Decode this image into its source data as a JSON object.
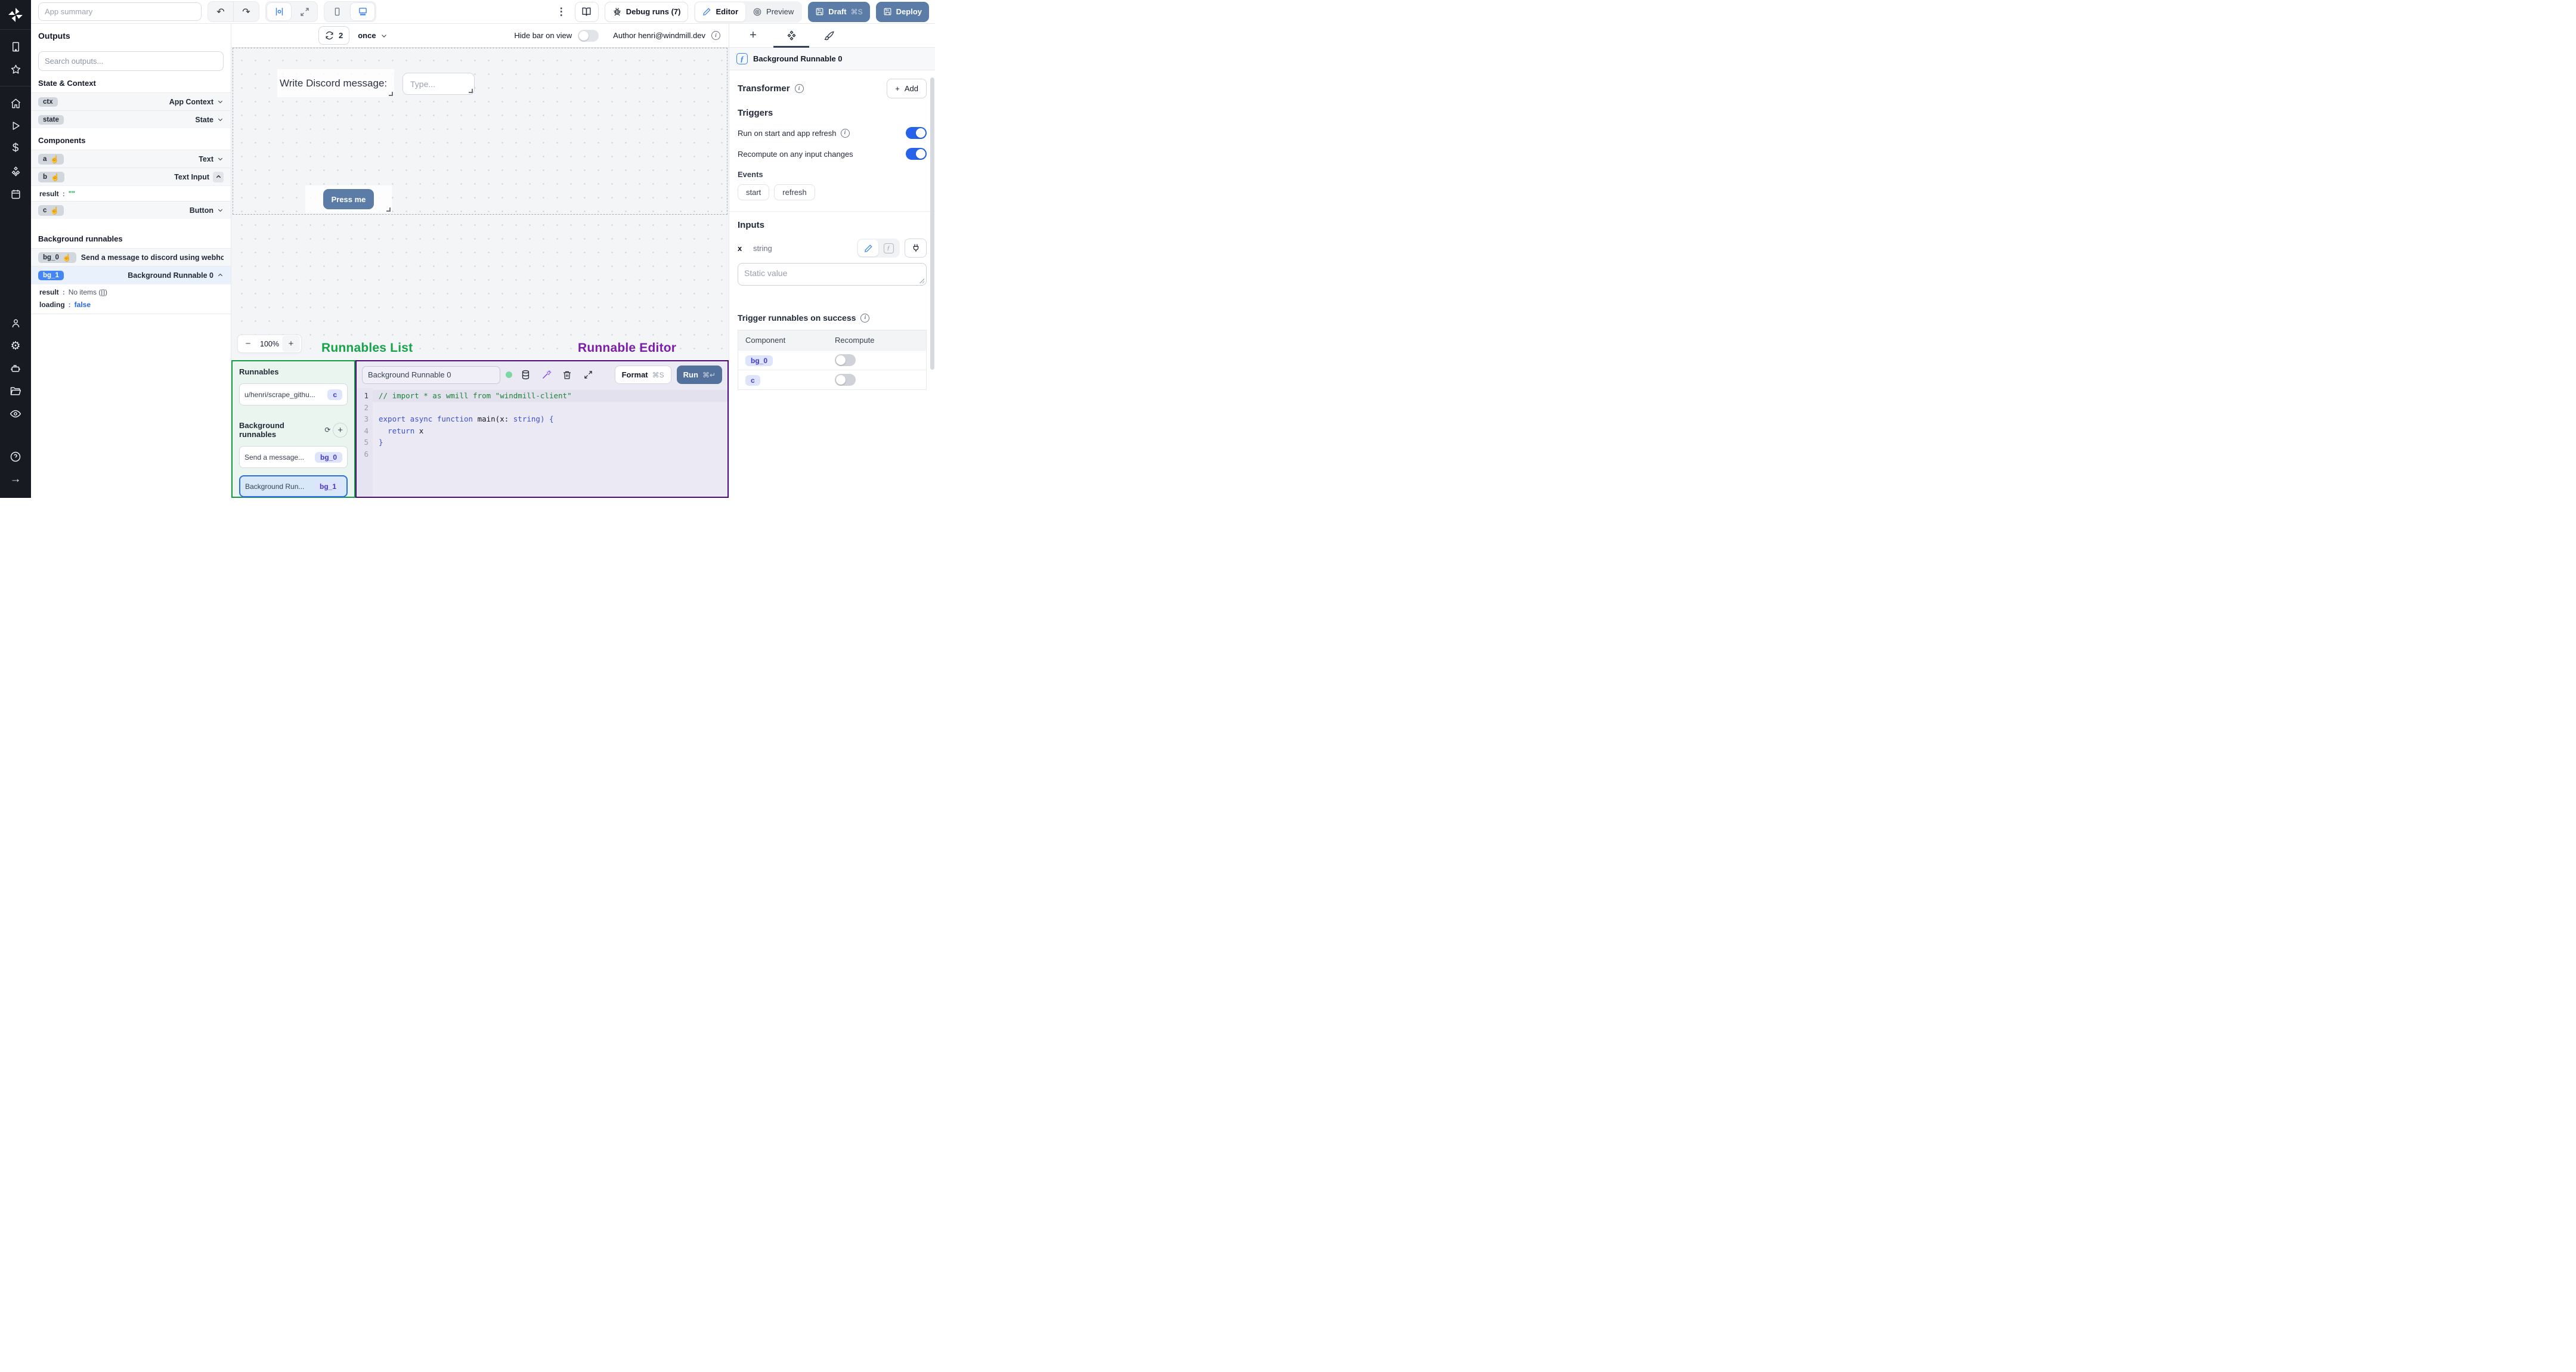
{
  "colors": {
    "accent_blue": "#3b82f6",
    "toggle_on_blue": "#2563eb",
    "slate_button": "#5b7ca6",
    "badge_blue": "#4486f6",
    "indigo_badge_bg": "#dde4fb",
    "indigo_badge_text": "#4338ca",
    "green_annotation": "#16a34a",
    "purple_annotation": "#7b1fa8",
    "green_panel_border": "#179a43",
    "purple_panel_border": "#4a0d78",
    "code_comment_green": "#1d8339",
    "code_keyword_blue": "#3b4fd9",
    "loading_false_blue": "#2563eb",
    "result_green": "#16a34a"
  },
  "icons": {
    "kebab": "⋮",
    "undo": "↶",
    "redo": "↷",
    "hand": "☝",
    "plus": "+",
    "minus": "−",
    "gear": "⚙",
    "dollar": "$",
    "question": "?",
    "arrow_right": "→",
    "fn": "ƒ",
    "refresh_small": "⟳",
    "info": "i"
  },
  "topbar": {
    "app_summary_placeholder": "App summary",
    "debug_runs_label": "Debug runs (7)",
    "editor_label": "Editor",
    "preview_label": "Preview",
    "draft_label": "Draft",
    "draft_shortcut": "⌘S",
    "deploy_label": "Deploy"
  },
  "canvas_bar": {
    "refresh_count": "2",
    "schedule_mode": "once",
    "hide_bar_label": "Hide bar on view",
    "author_label": "Author henri@windmill.dev"
  },
  "outputs": {
    "title": "Outputs",
    "search_placeholder": "Search outputs...",
    "state_context_heading": "State & Context",
    "ctx": {
      "badge": "ctx",
      "type": "App Context"
    },
    "state": {
      "badge": "state",
      "type": "State"
    },
    "components_heading": "Components",
    "comp_a": {
      "badge": "a",
      "type": "Text"
    },
    "comp_b": {
      "badge": "b",
      "type": "Text Input"
    },
    "comp_b_result_key": "result",
    "comp_b_result_value": "\"\"",
    "comp_c": {
      "badge": "c",
      "type": "Button"
    },
    "bg_heading": "Background runnables",
    "bg0": {
      "badge": "bg_0",
      "label": "Send a message to discord using webhoo"
    },
    "bg1": {
      "badge": "bg_1",
      "label": "Background Runnable 0"
    },
    "bg1_result_key": "result",
    "bg1_result_value": "No items ([])",
    "bg1_loading_key": "loading",
    "bg1_loading_value": "false"
  },
  "canvas": {
    "text_component": "Write Discord message:",
    "input_placeholder": "Type...",
    "button_label": "Press me",
    "zoom_level": "100%"
  },
  "annotations": {
    "runnables_list": "Runnables List",
    "runnable_editor": "Runnable Editor"
  },
  "runnables_panel": {
    "title": "Runnables",
    "inline_item": {
      "label": "u/henri/scrape_githu...",
      "badge": "c"
    },
    "bg_heading": "Background runnables",
    "items": [
      {
        "label": "Send a message...",
        "badge": "bg_0"
      },
      {
        "label": "Background Run...",
        "badge": "bg_1"
      }
    ]
  },
  "editor": {
    "name_value": "Background Runnable 0",
    "format_label": "Format",
    "format_shortcut": "⌘S",
    "run_label": "Run",
    "run_shortcut": "⌘↵",
    "code": {
      "lines": [
        {
          "n": "1",
          "active": true,
          "tokens": [
            {
              "t": "// import * as wmill from \"windmill-client\"",
              "c": "cm"
            }
          ]
        },
        {
          "n": "2",
          "tokens": []
        },
        {
          "n": "3",
          "tokens": [
            {
              "t": "export async function",
              "c": "kw"
            },
            {
              "t": " main(x: ",
              "c": "pl"
            },
            {
              "t": "string",
              "c": "kw"
            },
            {
              "t": ") {",
              "c": "kw"
            }
          ]
        },
        {
          "n": "4",
          "tokens": [
            {
              "t": "  ",
              "c": "pl"
            },
            {
              "t": "return",
              "c": "kw"
            },
            {
              "t": " x",
              "c": "pl"
            }
          ]
        },
        {
          "n": "5",
          "tokens": [
            {
              "t": "}",
              "c": "kw"
            }
          ]
        },
        {
          "n": "6",
          "tokens": []
        }
      ]
    }
  },
  "right_panel": {
    "header_title": "Background Runnable 0",
    "transformer_label": "Transformer",
    "add_label": "Add",
    "triggers_heading": "Triggers",
    "toggle_run_on_start": {
      "label": "Run on start and app refresh",
      "on": true
    },
    "toggle_recompute": {
      "label": "Recompute on any input changes",
      "on": true
    },
    "events_label": "Events",
    "event_pills": [
      "start",
      "refresh"
    ],
    "inputs_heading": "Inputs",
    "input_x": {
      "name": "x",
      "type": "string",
      "placeholder": "Static value"
    },
    "success_heading": "Trigger runnables on success",
    "table": {
      "headers": [
        "Component",
        "Recompute"
      ],
      "rows": [
        {
          "component": "bg_0",
          "recompute_on": false
        },
        {
          "component": "c",
          "recompute_on": false
        }
      ]
    }
  }
}
